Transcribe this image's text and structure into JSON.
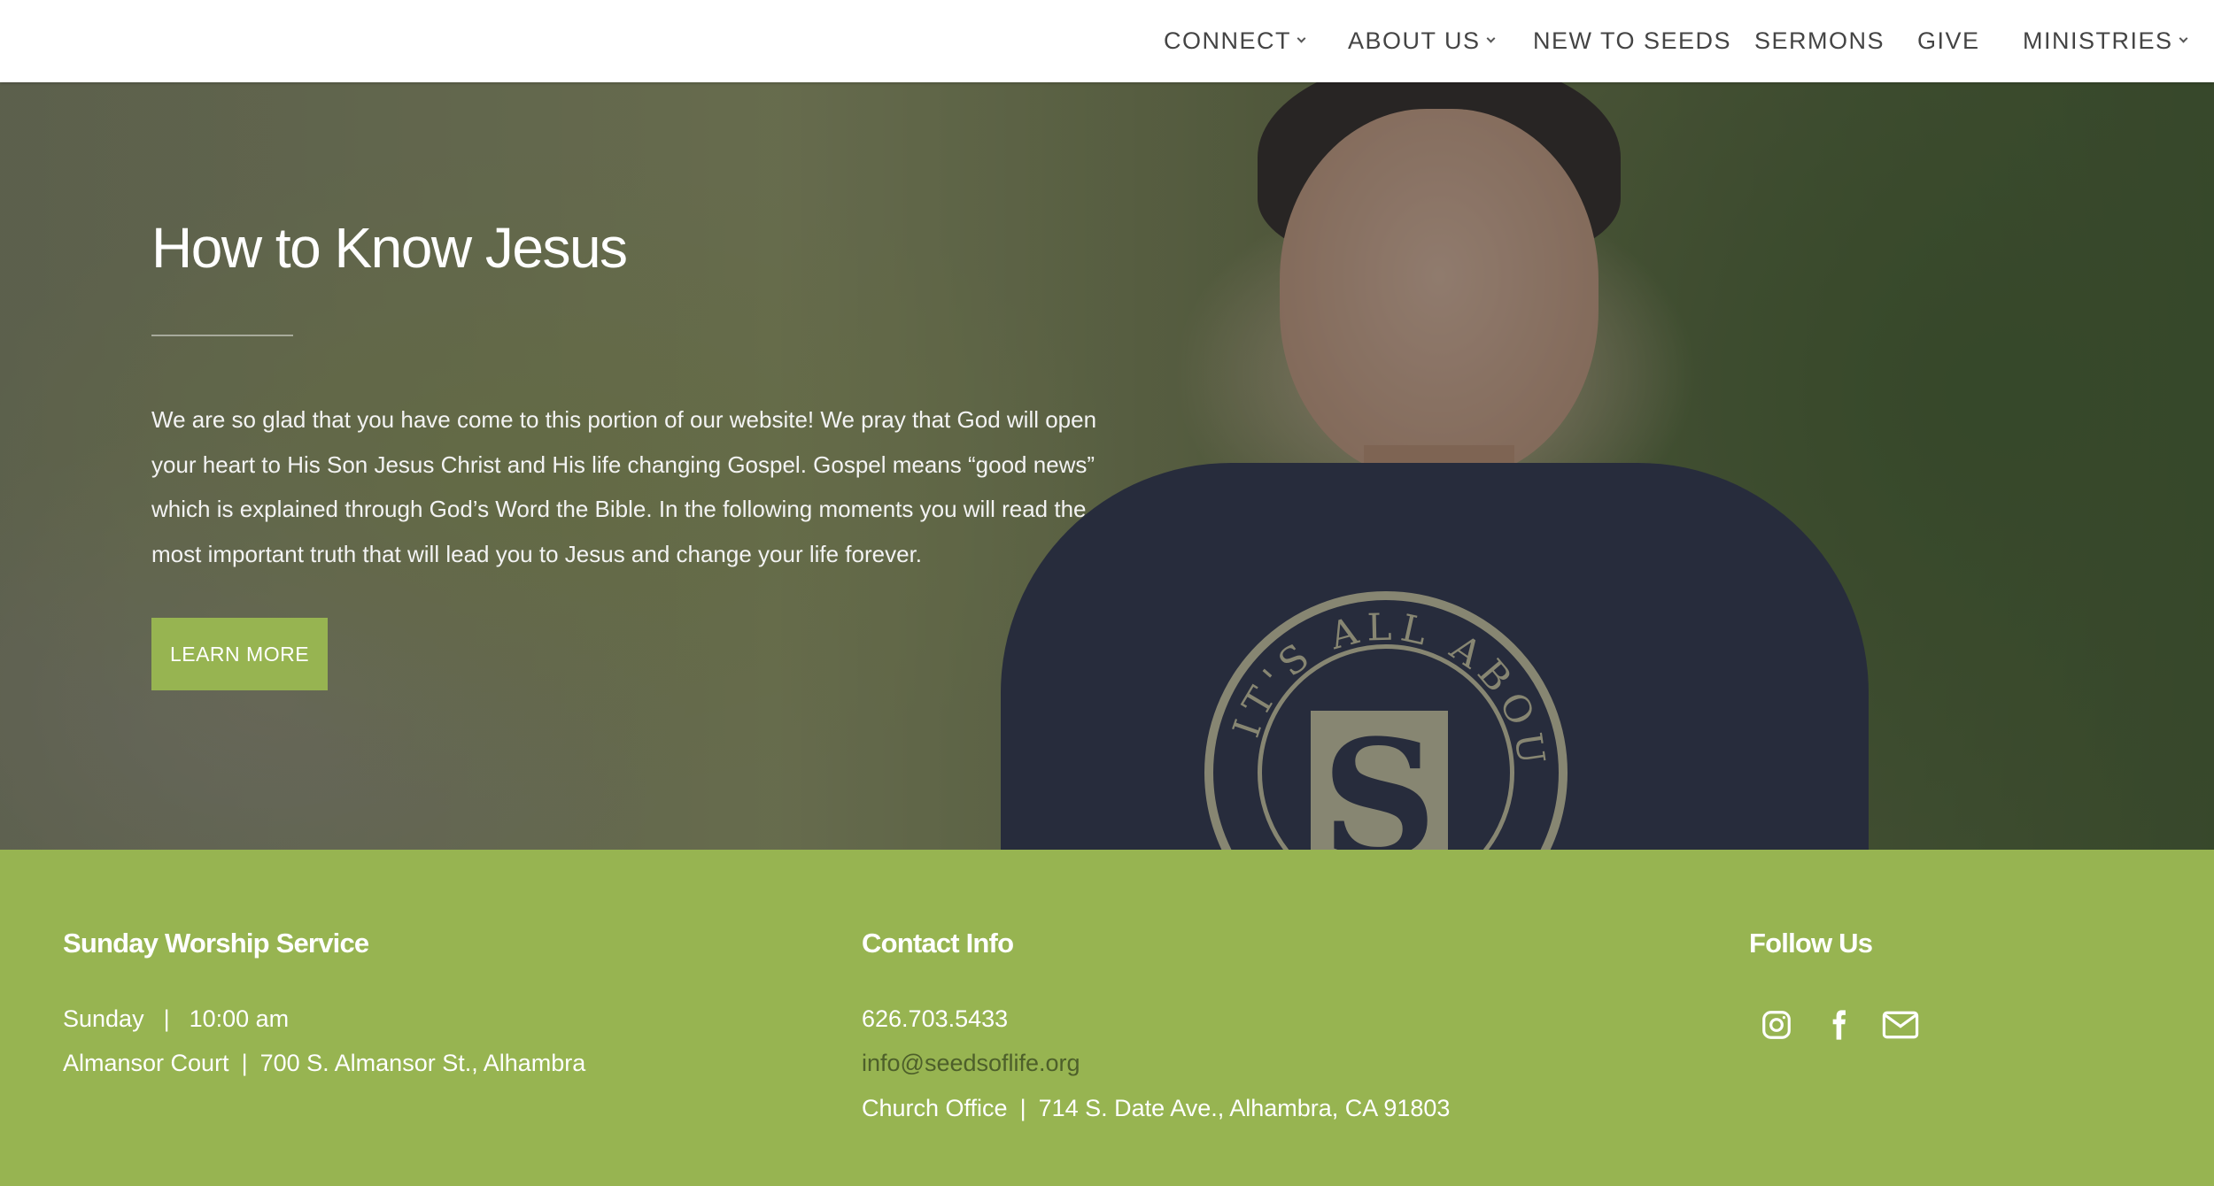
{
  "nav": {
    "items": [
      {
        "label": "CONNECT",
        "has_dropdown": true
      },
      {
        "label": "ABOUT US",
        "has_dropdown": true
      },
      {
        "label": "NEW TO SEEDS",
        "has_dropdown": false
      },
      {
        "label": "SERMONS",
        "has_dropdown": false
      },
      {
        "label": "GIVE",
        "has_dropdown": false
      },
      {
        "label": "MINISTRIES",
        "has_dropdown": true
      }
    ]
  },
  "hero": {
    "title": "How to Know Jesus",
    "body": "We are so glad that you have come to this portion of our website! We pray that God will open your heart to His Son Jesus Christ and His life changing Gospel. Gospel means “good news” which is explained through God’s Word the Bible. In the following moments you will read the most important truth that will lead you to Jesus and change your life forever.",
    "button_label": "LEARN MORE",
    "shirt_text": "IT'S ALL ABOUT",
    "shirt_letter": "S"
  },
  "footer": {
    "worship": {
      "heading": "Sunday Worship Service",
      "day": "Sunday",
      "time": "10:00 am",
      "venue": "Almansor Court",
      "address": "700 S. Almansor St., Alhambra"
    },
    "contact": {
      "heading": "Contact Info",
      "phone": "626.703.5433",
      "email": "info@seedsoflife.org",
      "office_label": "Church Office",
      "office_address": "714 S. Date Ave., Alhambra, CA 91803"
    },
    "follow": {
      "heading": "Follow Us",
      "icons": [
        "instagram-icon",
        "facebook-icon",
        "email-icon"
      ]
    }
  },
  "colors": {
    "accent_green": "#97b451",
    "nav_text": "#444444",
    "email_link": "#4d5f2a"
  }
}
